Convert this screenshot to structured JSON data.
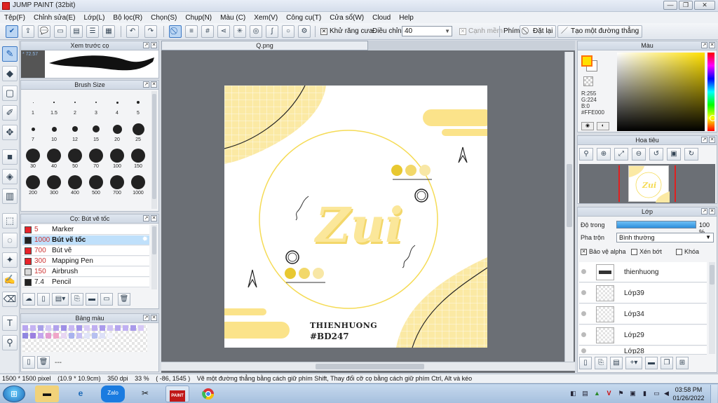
{
  "window": {
    "title": "JUMP PAINT (32bit)",
    "controls": [
      "—",
      "❐",
      "✕"
    ]
  },
  "menu": [
    "Tệp(F)",
    "Chỉnh sửa(E)",
    "Lớp(L)",
    "Bộ lọc(R)",
    "Chọn(S)",
    "Chụp(N)",
    "Màu (C)",
    "Xem(V)",
    "Công cụ(T)",
    "Cửa sổ(W)",
    "Cloud",
    "Help"
  ],
  "toolbar": {
    "antialias_label": "Khử răng cưa",
    "adjust_label": "Điều chỉnh",
    "adjust_value": "40",
    "taper_label": "Cạnh mềm",
    "keys_label": "Phím",
    "reset_label": "Đặt lại",
    "line_label": "Tạo một đường thẳng"
  },
  "preview": {
    "title": "Xem trước cọ",
    "size_text": "* 72.57"
  },
  "brush_size": {
    "title": "Brush Size",
    "sizes": [
      "1",
      "1.5",
      "2",
      "3",
      "4",
      "5",
      "7",
      "10",
      "12",
      "15",
      "20",
      "25",
      "30",
      "40",
      "50",
      "70",
      "100",
      "150",
      "200",
      "300",
      "400",
      "500",
      "700",
      "1000"
    ]
  },
  "brushes": {
    "title": "Cọ: Bút vẽ tốc",
    "items": [
      {
        "size": "5",
        "name": "Marker",
        "color": "#e8232a"
      },
      {
        "size": "1000",
        "name": "Bút vẽ tốc",
        "color": "#222222"
      },
      {
        "size": "700",
        "name": "Bút vẽ",
        "color": "#e8232a"
      },
      {
        "size": "300",
        "name": "Mapping Pen",
        "color": "#e8232a"
      },
      {
        "size": "150",
        "name": "Airbrush",
        "color": "#d9d9d9"
      },
      {
        "size": "7.4",
        "name": "Pencil",
        "color": "#222222"
      }
    ],
    "selected_index": 1
  },
  "palette": {
    "title": "Bảng màu",
    "more_label": "---"
  },
  "document": {
    "tab": "Q.png"
  },
  "artwork": {
    "word": "Zui",
    "name": "THIENHUONG",
    "tag": "#BD247"
  },
  "color_panel": {
    "title": "Màu",
    "r": "R:255",
    "g": "G:224",
    "b": "B:0",
    "hex": "#FFE000",
    "current_color": "#ffe000"
  },
  "navigator": {
    "title": "Hoa tiêu"
  },
  "layers": {
    "title": "Lớp",
    "opacity_label": "Độ trong",
    "opacity_value": "100 %",
    "blend_label": "Pha trộn",
    "blend_value": "Bình thường",
    "protect_alpha": "Bảo vệ alpha",
    "clipping": "Xén bớt",
    "lock": "Khóa",
    "items": [
      "thienhuong",
      "Lớp39",
      "Lớp34",
      "Lớp29",
      "Lớp28"
    ]
  },
  "status": {
    "dimensions": "1500 * 1500 pixel",
    "physical_size": "(10.9 * 10.9cm)",
    "dpi": "350 dpi",
    "zoom": "33 %",
    "cursor": "( -86, 1545 )",
    "hint": "Vẽ một đường thẳng bằng cách giữ phím Shift, Thay đổi cỡ cọ bằng cách giữ phím Ctrl, Alt và kéo"
  },
  "taskbar": {
    "time": "03:58 PM",
    "date": "01/26/2022",
    "zalo_label": "Zalo",
    "paint_label": "PAINT"
  }
}
